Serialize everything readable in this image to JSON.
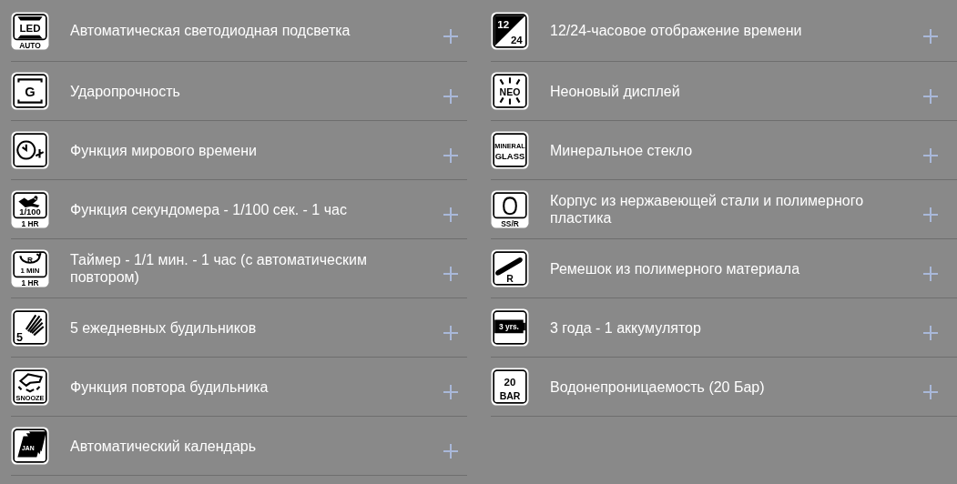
{
  "features": [
    {
      "title": "Автоматическая светодиодная подсветка",
      "badge": {
        "kind": "led",
        "texts": [
          "LED"
        ],
        "caption": "AUTO"
      }
    },
    {
      "title": "12/24-часовое отображение времени",
      "badge": {
        "kind": "hour-format",
        "texts": [
          "12",
          "24"
        ]
      }
    },
    {
      "title": "Ударопрочность",
      "badge": {
        "kind": "shock",
        "texts": [
          "G"
        ]
      }
    },
    {
      "title": "Неоновый дисплей",
      "badge": {
        "kind": "neon",
        "texts": [
          "NEO"
        ]
      }
    },
    {
      "title": "Функция мирового времени",
      "badge": {
        "kind": "world-time"
      }
    },
    {
      "title": "Минеральное стекло",
      "badge": {
        "kind": "glass",
        "texts": [
          "MINERAL",
          "GLASS"
        ]
      }
    },
    {
      "title": "Функция секундомера - 1/100 сек. - 1 час",
      "badge": {
        "kind": "stopwatch",
        "texts": [
          "1/100"
        ],
        "caption": "1 HR"
      }
    },
    {
      "title": "Корпус из нержавеющей стали и полимерного пластика",
      "badge": {
        "kind": "case",
        "caption": "SS/R"
      }
    },
    {
      "title": "Таймер - 1/1 мин. - 1 час (с автоматическим повтором)",
      "badge": {
        "kind": "timer",
        "texts": [
          "R",
          "1 MIN"
        ],
        "caption": "1 HR"
      }
    },
    {
      "title": "Ремешок из полимерного материала",
      "badge": {
        "kind": "strap",
        "texts": [
          "R"
        ]
      }
    },
    {
      "title": "5 ежедневных будильников",
      "badge": {
        "kind": "alarm",
        "texts": [
          "5"
        ]
      }
    },
    {
      "title": "3 года - 1 аккумулятор",
      "badge": {
        "kind": "battery",
        "texts": [
          "3 yrs."
        ]
      }
    },
    {
      "title": "Функция повтора будильника",
      "badge": {
        "kind": "snooze",
        "texts": [
          "SNOOZE"
        ]
      }
    },
    {
      "title": "Водонепроницаемость (20 Бар)",
      "badge": {
        "kind": "water",
        "texts": [
          "20",
          "BAR"
        ]
      }
    },
    {
      "title": "Автоматический календарь",
      "badge": {
        "kind": "calendar",
        "texts": [
          "JAN"
        ]
      }
    }
  ]
}
